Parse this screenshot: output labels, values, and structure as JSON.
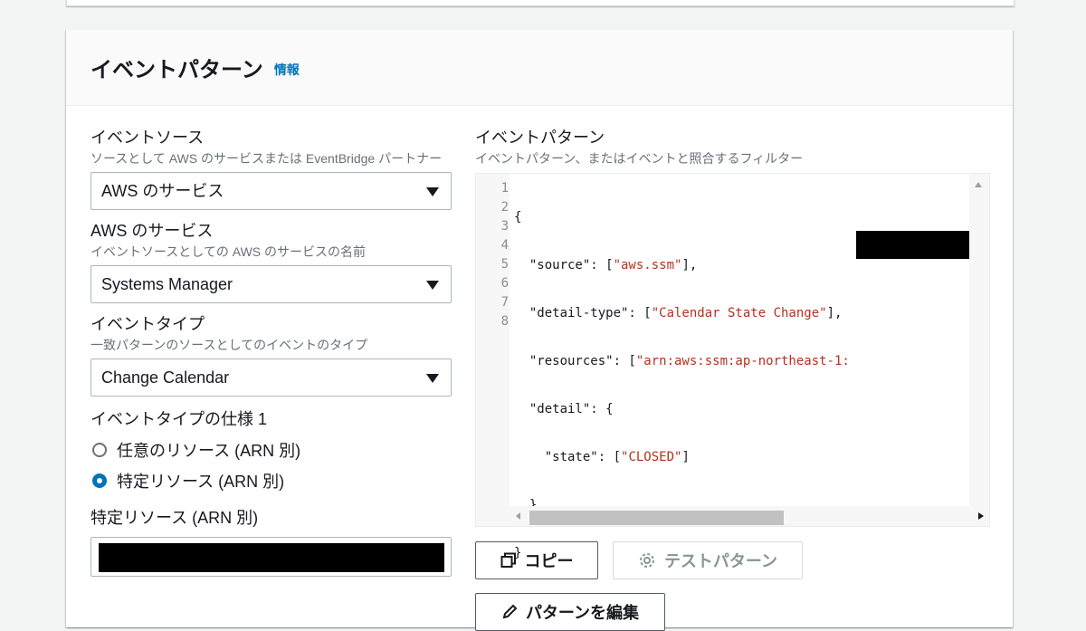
{
  "section": {
    "title": "イベントパターン",
    "info_link": "情報"
  },
  "left": {
    "event_source": {
      "label": "イベントソース",
      "description": "ソースとして AWS のサービスまたは EventBridge パートナー",
      "value": "AWS のサービス"
    },
    "aws_service": {
      "label": "AWS のサービス",
      "description": "イベントソースとしての AWS のサービスの名前",
      "value": "Systems Manager"
    },
    "event_type": {
      "label": "イベントタイプ",
      "description": "一致パターンのソースとしてのイベントのタイプ",
      "value": "Change Calendar"
    },
    "event_type_spec": {
      "label": "イベントタイプの仕様 1",
      "options": [
        {
          "label": "任意のリソース (ARN 別)",
          "checked": false
        },
        {
          "label": "特定リソース (ARN 別)",
          "checked": true
        }
      ]
    },
    "specific_resource": {
      "label": "特定リソース (ARN 別)"
    }
  },
  "right": {
    "label": "イベントパターン",
    "description": "イベントパターン、またはイベントと照合するフィルター",
    "line_numbers": [
      "1",
      "2",
      "3",
      "4",
      "5",
      "6",
      "7",
      "8"
    ],
    "code": {
      "l1": "{",
      "l2_key": "  \"source\": [",
      "l2_val": "\"aws.ssm\"",
      "l2_end": "],",
      "l3_key": "  \"detail-type\": [",
      "l3_val": "\"Calendar State Change\"",
      "l3_end": "],",
      "l4_key": "  \"resources\": [",
      "l4_val": "\"arn:aws:ssm:ap-northeast-1:",
      "l5": "  \"detail\": {",
      "l6_key": "    \"state\": [",
      "l6_val": "\"CLOSED\"",
      "l6_end": "]",
      "l7": "  }",
      "l8": "}"
    },
    "buttons": {
      "copy": "コピー",
      "test_pattern": "テストパターン",
      "edit_pattern": "パターンを編集"
    }
  }
}
